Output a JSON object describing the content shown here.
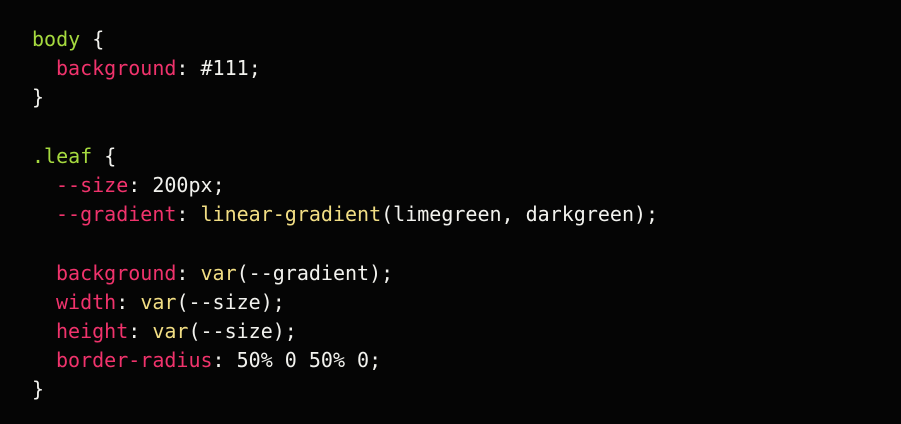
{
  "colors": {
    "background": "#050505",
    "selector": "#a6da3f",
    "property": "#f0336c",
    "function": "#f2de84",
    "text": "#f2f2ee"
  },
  "code": {
    "rule1": {
      "selector": "body",
      "open_brace": " {",
      "decl1": {
        "property": "background",
        "colon": ": ",
        "value": "#111",
        "semicolon": ";"
      },
      "close_brace": "}"
    },
    "rule2": {
      "selector": ".leaf",
      "open_brace": " {",
      "decl1": {
        "property": "--size",
        "colon": ": ",
        "value": "200px",
        "semicolon": ";"
      },
      "decl2": {
        "property": "--gradient",
        "colon": ": ",
        "func": "linear-gradient",
        "args": "(limegreen, darkgreen)",
        "semicolon": ";"
      },
      "decl3": {
        "property": "background",
        "colon": ": ",
        "func": "var",
        "args": "(--gradient)",
        "semicolon": ";"
      },
      "decl4": {
        "property": "width",
        "colon": ": ",
        "func": "var",
        "args": "(--size)",
        "semicolon": ";"
      },
      "decl5": {
        "property": "height",
        "colon": ": ",
        "func": "var",
        "args": "(--size)",
        "semicolon": ";"
      },
      "decl6": {
        "property": "border-radius",
        "colon": ": ",
        "value": "50% 0 50% 0",
        "semicolon": ";"
      },
      "close_brace": "}"
    }
  }
}
